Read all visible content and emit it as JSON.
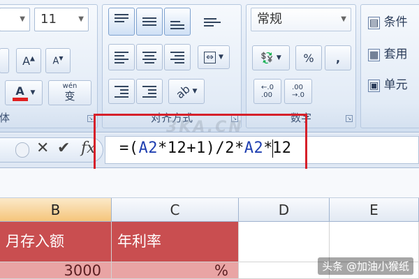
{
  "ribbon": {
    "font": {
      "size_value": "11",
      "title": "体",
      "grow_icon": "font-grow-icon",
      "shrink_icon": "font-shrink-icon",
      "color_icon": "font-color-icon",
      "phonetic_label": "wén",
      "phonetic_char": "变"
    },
    "alignment": {
      "title": "对齐方式"
    },
    "number": {
      "format_value": "常规",
      "percent_label": "%",
      "comma_label": ",",
      "title": "数字"
    },
    "styles": {
      "items": [
        "条件",
        "套用",
        "单元"
      ]
    }
  },
  "formula_bar": {
    "cancel_label": "✕",
    "enter_label": "✔",
    "fx_label": "fx",
    "formula_prefix": "=(",
    "ref1": "A2",
    "part2": "*12+1)/2*",
    "ref2": "A2",
    "part3": "*",
    "part4": "12"
  },
  "watermark": "3KA.CN",
  "sheet": {
    "columns": [
      "B",
      "C",
      "D",
      "E"
    ],
    "active_column": "B",
    "row_header": {
      "B": "月存入额",
      "C": "年利率"
    },
    "row_values": {
      "B": "3000",
      "C": "%"
    }
  },
  "footer_mark": "头条 @加油小猴纸",
  "colors": {
    "highlight_border": "#d6202a",
    "header_fill": "#c94e50",
    "row_fill": "#e9a4a4",
    "active_column": "#f5c57b"
  }
}
